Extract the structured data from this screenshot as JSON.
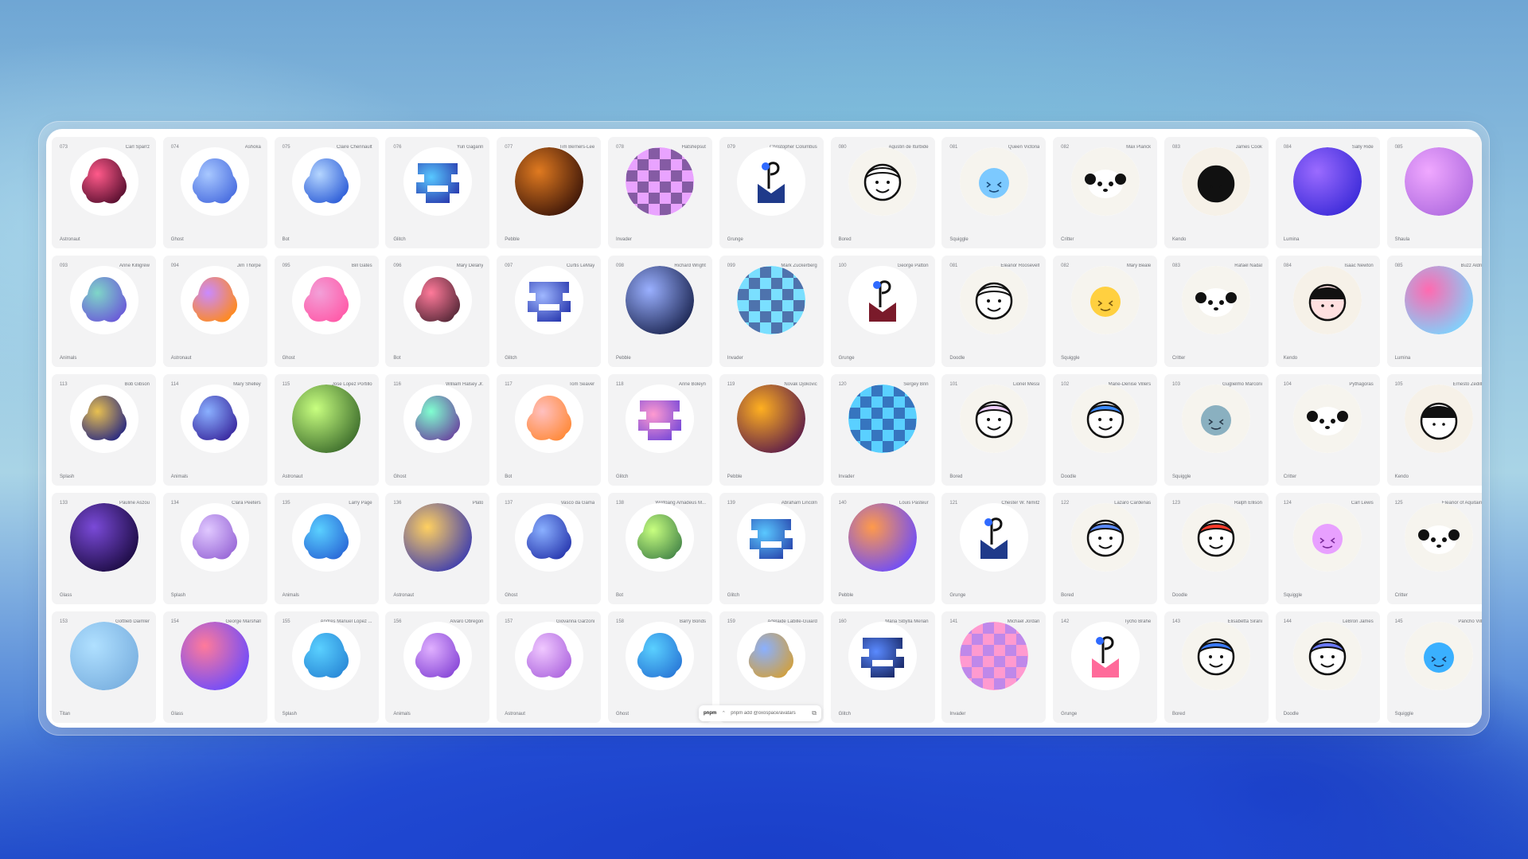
{
  "toolbar": {
    "icons": [
      "info-icon",
      "grid-icon",
      "sun-icon",
      "sliders-icon"
    ],
    "glyphs": [
      "ⓘ",
      "▦",
      "☼",
      "⚌"
    ]
  },
  "command_bar": {
    "package_manager": "pnpm",
    "selector_glyph": "⌃",
    "command": "pnpm add @oxospace/avatars",
    "copy_glyph": "⧉"
  },
  "avatars": [
    {
      "num": "073",
      "name": "Carl Sparrz",
      "kind": "Astronaut",
      "style": "blob",
      "c1": "#ff5a8a",
      "c2": "#5a1030"
    },
    {
      "num": "074",
      "name": "Ashoka",
      "kind": "Ghost",
      "style": "blob",
      "c1": "#a8c8ff",
      "c2": "#4a6ee0"
    },
    {
      "num": "075",
      "name": "Claire Chennault",
      "kind": "Bot",
      "style": "blob",
      "c1": "#b5d6ff",
      "c2": "#2f5fd8"
    },
    {
      "num": "076",
      "name": "Yuri Gagarin",
      "kind": "Glitch",
      "style": "glitch",
      "c1": "#58c8ff",
      "c2": "#2a3db0"
    },
    {
      "num": "077",
      "name": "Tim Berners-Lee",
      "kind": "Pebble",
      "style": "orb",
      "c1": "#e07a20",
      "c2": "#3a1408"
    },
    {
      "num": "078",
      "name": "Hatshepsut",
      "kind": "Invader",
      "style": "pixel",
      "c1": "#e9a3ff",
      "c2": "#33205a"
    },
    {
      "num": "079",
      "name": "Christopher Columbus",
      "kind": "Grunge",
      "style": "grunge",
      "c1": "#1f3a8a",
      "c2": "#ffffff"
    },
    {
      "num": "080",
      "name": "Agustin de Iturbide",
      "kind": "Bored",
      "style": "face",
      "c1": "#ffffff",
      "c2": "#111111"
    },
    {
      "num": "081",
      "name": "Queen Victoria",
      "kind": "Squiggle",
      "style": "squiggle",
      "c1": "#7cc9ff",
      "c2": "#1a4a7a"
    },
    {
      "num": "082",
      "name": "Max Planck",
      "kind": "Critter",
      "style": "critter",
      "c1": "#ffffff",
      "c2": "#111111"
    },
    {
      "num": "083",
      "name": "James Cook",
      "kind": "Kendo",
      "style": "kendo",
      "c1": "#111111",
      "c2": "#ffffff"
    },
    {
      "num": "084",
      "name": "Sally Ride",
      "kind": "Lumina",
      "style": "orb",
      "c1": "#9b6bff",
      "c2": "#3a2ad8"
    },
    {
      "num": "085",
      "name": "",
      "kind": "Shaula",
      "style": "orb",
      "c1": "#f0a8ff",
      "c2": "#b06be0"
    },
    {
      "num": "093",
      "name": "Anne Killigrew",
      "kind": "Animals",
      "style": "blob",
      "c1": "#7fd6c8",
      "c2": "#6a5ad8"
    },
    {
      "num": "094",
      "name": "Jim Thorpe",
      "kind": "Astronaut",
      "style": "blob",
      "c1": "#c98aff",
      "c2": "#ff8a1a"
    },
    {
      "num": "095",
      "name": "Bill Gates",
      "kind": "Ghost",
      "style": "blob",
      "c1": "#f2a0d8",
      "c2": "#ff5aa8"
    },
    {
      "num": "096",
      "name": "Mary Delany",
      "kind": "Bot",
      "style": "blob",
      "c1": "#ff7a9a",
      "c2": "#5a2a3a"
    },
    {
      "num": "097",
      "name": "Curtis LeMay",
      "kind": "Glitch",
      "style": "glitch",
      "c1": "#a0b8ff",
      "c2": "#2a3ab0"
    },
    {
      "num": "098",
      "name": "Richard Wright",
      "kind": "Pebble",
      "style": "orb",
      "c1": "#9ab0ff",
      "c2": "#1a2450"
    },
    {
      "num": "099",
      "name": "Mark Zuckerberg",
      "kind": "Invader",
      "style": "pixel",
      "c1": "#7adfff",
      "c2": "#2a1a6a"
    },
    {
      "num": "100",
      "name": "George Patton",
      "kind": "Grunge",
      "style": "grunge",
      "c1": "#7a1a2a",
      "c2": "#ff3a3a"
    },
    {
      "num": "081",
      "name": "Eleanor Roosevelt",
      "kind": "Doodle",
      "style": "face",
      "c1": "#ffffff",
      "c2": "#111111"
    },
    {
      "num": "082",
      "name": "Mary Beale",
      "kind": "Squiggle",
      "style": "squiggle",
      "c1": "#ffd040",
      "c2": "#7a5a10"
    },
    {
      "num": "083",
      "name": "Rafael Nadal",
      "kind": "Critter",
      "style": "critter",
      "c1": "#ffffff",
      "c2": "#111111"
    },
    {
      "num": "084",
      "name": "Isaac Newton",
      "kind": "Kendo",
      "style": "kendo",
      "c1": "#ffe0e0",
      "c2": "#111111"
    },
    {
      "num": "085",
      "name": "Buzz Aldrin",
      "kind": "Lumina",
      "style": "orb",
      "c1": "#ff6ab0",
      "c2": "#7ad6ff"
    },
    {
      "num": "113",
      "name": "Bob Gibson",
      "kind": "Splash",
      "style": "blob",
      "c1": "#e8c050",
      "c2": "#2a2a80"
    },
    {
      "num": "114",
      "name": "Mary Shelley",
      "kind": "Animals",
      "style": "blob",
      "c1": "#8ab0ff",
      "c2": "#3a2aa0"
    },
    {
      "num": "115",
      "name": "Jose Lopez Portillo",
      "kind": "Astronaut",
      "style": "orb",
      "c1": "#c8ff80",
      "c2": "#3a6a2a"
    },
    {
      "num": "116",
      "name": "William Halsey Jr.",
      "kind": "Ghost",
      "style": "blob",
      "c1": "#80ffd0",
      "c2": "#6a4aa0"
    },
    {
      "num": "117",
      "name": "Tom Seaver",
      "kind": "Bot",
      "style": "blob",
      "c1": "#ffc0c0",
      "c2": "#ff8a3a"
    },
    {
      "num": "118",
      "name": "Anne Boleyn",
      "kind": "Glitch",
      "style": "glitch",
      "c1": "#ff9ad0",
      "c2": "#7a4ad8"
    },
    {
      "num": "119",
      "name": "Novak Djokovic",
      "kind": "Pebble",
      "style": "orb",
      "c1": "#ffb020",
      "c2": "#5a1a4a"
    },
    {
      "num": "120",
      "name": "Sergey Brin",
      "kind": "Invader",
      "style": "pixel",
      "c1": "#5ad0ff",
      "c2": "#1a2a8a"
    },
    {
      "num": "101",
      "name": "Lionel Messi",
      "kind": "Bored",
      "style": "face",
      "c1": "#f0d0ff",
      "c2": "#111111"
    },
    {
      "num": "102",
      "name": "Marie-Denise Villers",
      "kind": "Doodle",
      "style": "face",
      "c1": "#3a8aff",
      "c2": "#111111"
    },
    {
      "num": "103",
      "name": "Guglielmo Marconi",
      "kind": "Squiggle",
      "style": "squiggle",
      "c1": "#8ab0c0",
      "c2": "#2a3a4a"
    },
    {
      "num": "104",
      "name": "Pythagoras",
      "kind": "Critter",
      "style": "critter",
      "c1": "#ffffff",
      "c2": "#111111"
    },
    {
      "num": "105",
      "name": "Ernesto Zedillo",
      "kind": "Kendo",
      "style": "kendo",
      "c1": "#ffffff",
      "c2": "#111111"
    },
    {
      "num": "133",
      "name": "Pauline Aszou",
      "kind": "Glass",
      "style": "orb",
      "c1": "#7a4ad8",
      "c2": "#1a0a40"
    },
    {
      "num": "134",
      "name": "Clara Peeters",
      "kind": "Splash",
      "style": "blob",
      "c1": "#e0c8ff",
      "c2": "#9a6ad8"
    },
    {
      "num": "135",
      "name": "Larry Page",
      "kind": "Animals",
      "style": "blob",
      "c1": "#5ad0ff",
      "c2": "#2a6ad8"
    },
    {
      "num": "136",
      "name": "Plato",
      "kind": "Astronaut",
      "style": "orb",
      "c1": "#ffd060",
      "c2": "#3a3ab0"
    },
    {
      "num": "137",
      "name": "Vasco da Gama",
      "kind": "Ghost",
      "style": "blob",
      "c1": "#8ab0ff",
      "c2": "#2a3ab0"
    },
    {
      "num": "138",
      "name": "Wolfgang Amadeus M...",
      "kind": "Bot",
      "style": "blob",
      "c1": "#c8ff80",
      "c2": "#4a8a4a"
    },
    {
      "num": "139",
      "name": "Abraham Lincoln",
      "kind": "Glitch",
      "style": "glitch",
      "c1": "#5ac8ff",
      "c2": "#2a4ab0"
    },
    {
      "num": "140",
      "name": "Louis Pasteur",
      "kind": "Pebble",
      "style": "orb",
      "c1": "#ff9a4a",
      "c2": "#6a4aff"
    },
    {
      "num": "121",
      "name": "Chester W. Nimitz",
      "kind": "Grunge",
      "style": "grunge",
      "c1": "#1f3a8a",
      "c2": "#ffffff"
    },
    {
      "num": "122",
      "name": "Lazaro Cardenas",
      "kind": "Bored",
      "style": "face",
      "c1": "#5a8aff",
      "c2": "#111111"
    },
    {
      "num": "123",
      "name": "Ralph Ellison",
      "kind": "Doodle",
      "style": "face",
      "c1": "#ff3a2a",
      "c2": "#111111"
    },
    {
      "num": "124",
      "name": "Carl Lewis",
      "kind": "Squiggle",
      "style": "squiggle",
      "c1": "#e8a0ff",
      "c2": "#7a2a9a"
    },
    {
      "num": "125",
      "name": "Eleanor of Aquitaine",
      "kind": "Critter",
      "style": "critter",
      "c1": "#ffffff",
      "c2": "#111111"
    },
    {
      "num": "153",
      "name": "Gottlieb Daimler",
      "kind": "Titan",
      "style": "orb",
      "c1": "#b0e0ff",
      "c2": "#7ab0e0"
    },
    {
      "num": "154",
      "name": "George Marshall",
      "kind": "Glass",
      "style": "orb",
      "c1": "#ff7a9a",
      "c2": "#6a4aff"
    },
    {
      "num": "155",
      "name": "Andres Manuel Lopez ...",
      "kind": "Splash",
      "style": "blob",
      "c1": "#5ad0ff",
      "c2": "#2a8ad8"
    },
    {
      "num": "156",
      "name": "Alvaro Obregon",
      "kind": "Animals",
      "style": "blob",
      "c1": "#e0b0ff",
      "c2": "#8a4ad8"
    },
    {
      "num": "157",
      "name": "Giovanna Garzoni",
      "kind": "Astronaut",
      "style": "blob",
      "c1": "#f0c8ff",
      "c2": "#b06ae0"
    },
    {
      "num": "158",
      "name": "Barry Bonds",
      "kind": "Ghost",
      "style": "blob",
      "c1": "#5ad0ff",
      "c2": "#2a7ad8"
    },
    {
      "num": "159",
      "name": "Adelaide Labille-Guiard",
      "kind": "",
      "style": "blob",
      "c1": "#8ab0ff",
      "c2": "#d0a040"
    },
    {
      "num": "160",
      "name": "Maria Sibylla Merian",
      "kind": "Glitch",
      "style": "glitch",
      "c1": "#5a8aff",
      "c2": "#1a2a6a"
    },
    {
      "num": "141",
      "name": "Michael Jordan",
      "kind": "Invader",
      "style": "pixel",
      "c1": "#ff9ad0",
      "c2": "#8a7aff"
    },
    {
      "num": "142",
      "name": "Tycho Brahe",
      "kind": "Grunge",
      "style": "grunge",
      "c1": "#ff6a9a",
      "c2": "#5a1a2a"
    },
    {
      "num": "143",
      "name": "Elisabetta Sirani",
      "kind": "Bored",
      "style": "face",
      "c1": "#3a7aff",
      "c2": "#111111"
    },
    {
      "num": "144",
      "name": "LeBron James",
      "kind": "Doodle",
      "style": "face",
      "c1": "#6a7aff",
      "c2": "#111111"
    },
    {
      "num": "145",
      "name": "Pancho Villa",
      "kind": "Squiggle",
      "style": "squiggle",
      "c1": "#3ab0ff",
      "c2": "#1a3a6a"
    }
  ]
}
